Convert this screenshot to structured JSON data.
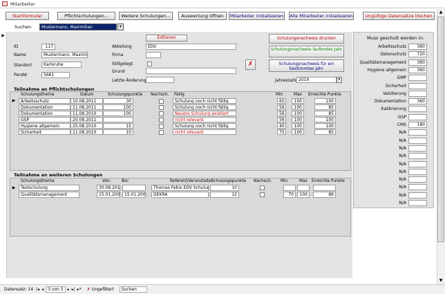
{
  "window": {
    "title": "Mitarbeiter"
  },
  "toolbar": {
    "startformular": "Startformular",
    "pflichtschulungen": "Pflichtschulungen...",
    "weitere": "Weitere Schulungen...",
    "auswertung": "Auswertung öffnen",
    "mitarbeiter_init": "Mitarbeiter initialisieren",
    "alle_init": "Alle Mitarbeiter initialisieren",
    "ungueltige": "Ungültige Datensätze löschen"
  },
  "search": {
    "label": "Suchen",
    "value": "Mustermann, Maximilian"
  },
  "form": {
    "id_label": "ID",
    "id_value": "117",
    "name_label": "Name",
    "name_value": "Mustermann, Maximilian",
    "standort_label": "Standort",
    "standort_value": "Karlsruhe",
    "persnr_label": "PersNr",
    "persnr_value": "5661",
    "editieren": "Editieren",
    "abteilung_label": "Abteilung",
    "abteilung_value": "EDV",
    "firma_label": "Firma",
    "firma_value": "",
    "stillgelegt_label": "Stillgelegt",
    "grund_label": "Grund",
    "grund_value": "",
    "letzte_label": "Letzte Änderung",
    "letzte_value": "",
    "btn_druck": "Schulungsnachweis drucken",
    "btn_laufendes": "Schulungsnachweis laufendes Jahr",
    "btn_bestimmt": "Schulungsnachweis für ein bestimmtes Jahr",
    "jahr_label": "Jahreszahl",
    "jahr_value": "2010"
  },
  "pflicht": {
    "section": "Teilnahme an Pflichtschulungen",
    "headers": [
      "Schulungsthema",
      "Datum",
      "Schulungspunkte",
      "Nachsch.",
      "Fällig",
      "Min",
      "Max",
      "Erreichte Punkte"
    ],
    "rows": [
      {
        "thema": "Arbeitsschutz",
        "datum": "10.08.2011",
        "punkte": "30",
        "faellig": "Schulung noch nicht fällig",
        "min": "60",
        "max": "100",
        "erreicht": "100"
      },
      {
        "thema": "Dokumentation",
        "datum": "11.08.2011",
        "punkte": "100",
        "faellig": "Schulung noch nicht fällig",
        "min": "56",
        "max": "100",
        "erreicht": "85"
      },
      {
        "thema": "Dokumentation",
        "datum": "11.08.2010",
        "punkte": "100",
        "faellig": "Neuere Schulung existiert",
        "min": "56",
        "max": "100",
        "erreicht": "85"
      },
      {
        "thema": "GSP",
        "datum": "20.08.2011",
        "punkte": "",
        "faellig": "nicht relevant",
        "min": "56",
        "max": "100",
        "erreicht": "100"
      },
      {
        "thema": "Hygiene allgemein",
        "datum": "25.08.2010",
        "punkte": "15",
        "faellig": "Schulung noch nicht fällig",
        "min": "40",
        "max": "100",
        "erreicht": "100"
      },
      {
        "thema": "Sicherheit",
        "datum": "11.08.2010",
        "punkte": "10",
        "faellig": "nicht relevant",
        "min": "75",
        "max": "100",
        "erreicht": "85"
      }
    ]
  },
  "weitere": {
    "section": "Teilnahme an weiteren Schulungen",
    "headers": [
      "Schulungsthema",
      "Von:",
      "Bis:",
      "Referent/Veranstalter",
      "Schulungspunkte",
      "Nachsch.",
      "Min",
      "Max",
      "Erreichte Punkte"
    ],
    "rows": [
      {
        "thema": "Testschulung",
        "von": "30.08.2010",
        "bis": "",
        "referent": "Thomas Febix EDV Schulungen",
        "punkte": "10",
        "min": "",
        "max": "",
        "erreicht": ""
      },
      {
        "thema": "Qualitätsmanagement",
        "von": "15.01.2009",
        "bis": "15.01.2009",
        "referent": "DEKRA",
        "punkte": "12",
        "min": "70",
        "max": "100",
        "erreicht": "89"
      }
    ]
  },
  "punkte": {
    "title": "Muss geschult werden in:",
    "rows": [
      {
        "label": "Arbeitsschutz",
        "value": "360"
      },
      {
        "label": "Datenschutz",
        "value": "720"
      },
      {
        "label": "Qualitätsmanagement",
        "value": "360"
      },
      {
        "label": "Hygiene allgemein",
        "value": "360"
      },
      {
        "label": "GMP",
        "value": ""
      },
      {
        "label": "Sicherheit",
        "value": ""
      },
      {
        "label": "Validierung",
        "value": ""
      },
      {
        "label": "Dokumentation",
        "value": "360"
      },
      {
        "label": "Kalibrierung",
        "value": ""
      },
      {
        "label": "GSP",
        "value": ""
      },
      {
        "label": "CMS",
        "value": "180"
      },
      {
        "label": "N/A",
        "value": ""
      },
      {
        "label": "N/A",
        "value": ""
      },
      {
        "label": "N/A",
        "value": ""
      },
      {
        "label": "N/A",
        "value": ""
      },
      {
        "label": "N/A",
        "value": ""
      },
      {
        "label": "N/A",
        "value": ""
      },
      {
        "label": "N/A",
        "value": ""
      },
      {
        "label": "N/A",
        "value": ""
      },
      {
        "label": "N/A",
        "value": ""
      },
      {
        "label": "N/A",
        "value": ""
      }
    ]
  },
  "status": {
    "datensatz": "Datensatz: 14",
    "position": "3 von 5",
    "ungefiltert": "Ungefiltert",
    "suchen": "Suchen"
  }
}
